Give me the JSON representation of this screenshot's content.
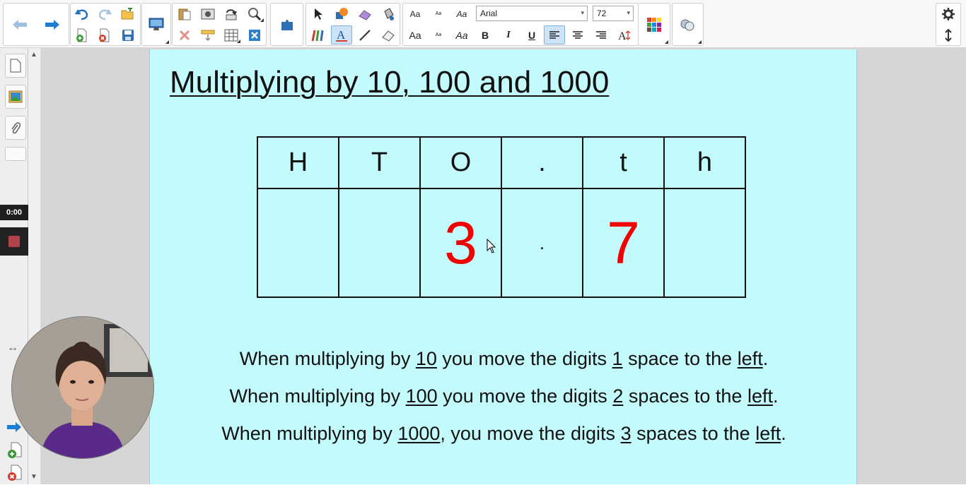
{
  "toolbar": {
    "font_name": "Arial",
    "font_size": "72",
    "text_sizes": [
      "Aa",
      "Aa",
      "Aa",
      "Aa",
      "Aa",
      "Aa"
    ],
    "bold_label": "B",
    "italic_label": "I",
    "underline_label": "U",
    "icons": [
      "back-arrow-icon",
      "forward-arrow-icon",
      "undo-icon",
      "redo-icon",
      "open-icon",
      "add-page-icon",
      "delete-page-icon",
      "save-icon",
      "display-icon",
      "paste-icon",
      "screenshade-icon",
      "rotate-icon",
      "magic-pen-icon",
      "delete-icon",
      "table-icon",
      "close-box-icon",
      "addon-icon",
      "select-icon",
      "shapes-icon",
      "eraser-fill-icon",
      "fill-icon",
      "pens-icon",
      "text-icon",
      "line-icon",
      "eraser-icon",
      "align-left-icon",
      "align-center-icon",
      "align-right-icon",
      "font-size-icon",
      "color-palette-icon",
      "properties-icon",
      "settings-icon",
      "move-toolbar-icon"
    ],
    "colors": {
      "accent": "#1e7fd0",
      "active_bg": "#cde3f7"
    }
  },
  "sidebar": {
    "timer": "0:00"
  },
  "slide": {
    "background": "#c3fbfc",
    "title": "Multiplying by 10, 100 and 1000",
    "table": {
      "headers": [
        "H",
        "T",
        "O",
        ".",
        "t",
        "h"
      ],
      "values": [
        "",
        "",
        "3",
        ".",
        "7",
        ""
      ]
    },
    "rules": [
      {
        "p1": "When multiplying by ",
        "factor": "10",
        "p2": " you move the digits ",
        "count": "1",
        "p3": " space to the ",
        "dir": "left",
        "p4": "."
      },
      {
        "p1": "When multiplying by ",
        "factor": "100",
        "p2": " you move the digits ",
        "count": "2",
        "p3": " spaces to the ",
        "dir": "left",
        "p4": "."
      },
      {
        "p1": "When multiplying by ",
        "factor": "1000",
        "p2": ", you move the digits ",
        "count": "3",
        "p3": " spaces to the ",
        "dir": "left",
        "p4": "."
      }
    ],
    "digit_color": "#f20000"
  }
}
